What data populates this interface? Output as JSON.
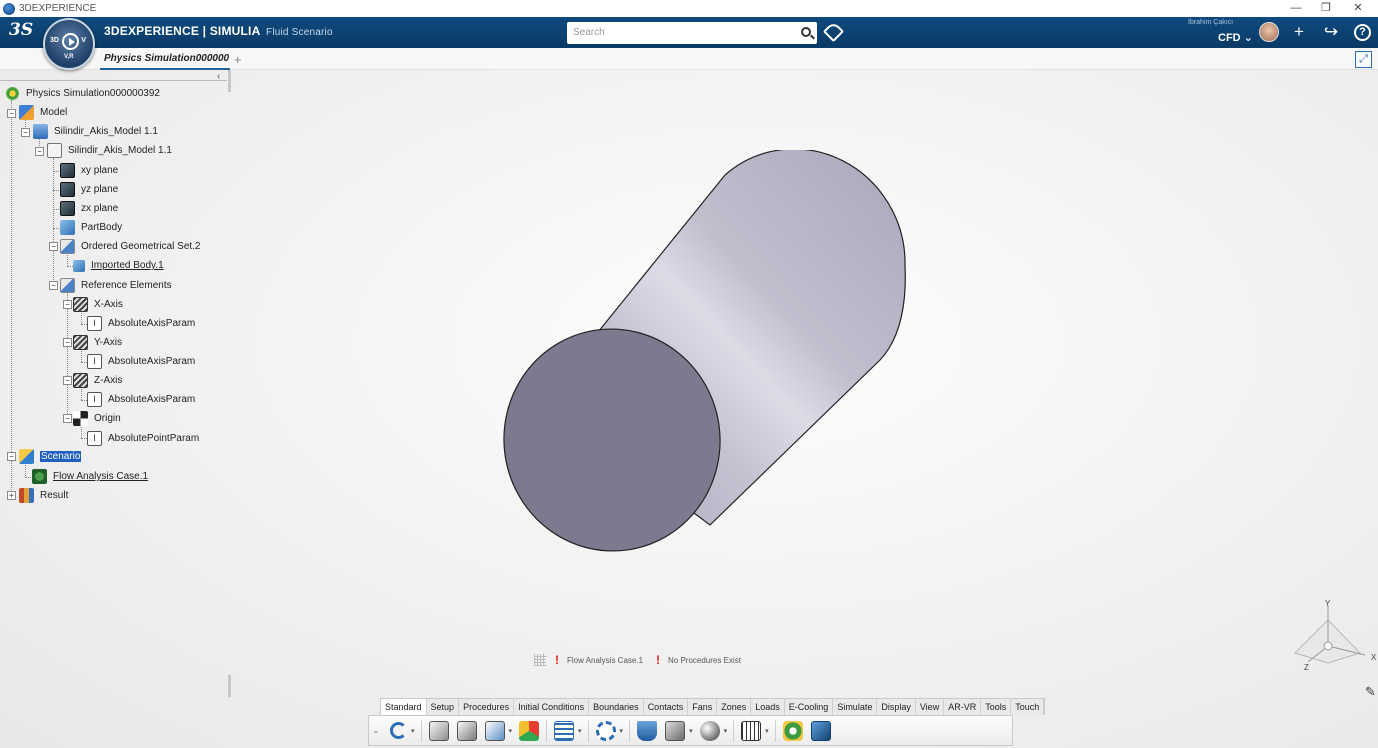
{
  "window": {
    "title": "3DEXPERIENCE",
    "minimize": "—",
    "restore": "❐",
    "close": "✕"
  },
  "topbar": {
    "logo": "3S",
    "compass_label_3d": "3D",
    "compass_label_v": "V",
    "compass_label_vr": "V,R",
    "brand_prefix": "3D",
    "brand_main": "EXPERIENCE | SIMULIA",
    "brand_app": "Fluid Scenario",
    "search_placeholder": "Search",
    "user_name": "İbrahim Çakıcı",
    "role": "CFD ⌄",
    "add_icon": "+",
    "share_icon": "↪",
    "help_icon": "?"
  },
  "tabs": {
    "active_tab": "Physics Simulation000000",
    "add": "+"
  },
  "tree": {
    "collapse": "‹",
    "nodes": [
      {
        "label": "Physics Simulation000000392"
      },
      {
        "label": "Model"
      },
      {
        "label": "Silindir_Akis_Model 1.1"
      },
      {
        "label": "Silindir_Akis_Model 1.1"
      },
      {
        "label": "xy plane"
      },
      {
        "label": "yz plane"
      },
      {
        "label": "zx plane"
      },
      {
        "label": "PartBody"
      },
      {
        "label": "Ordered Geometrical Set.2"
      },
      {
        "label": "Imported Body.1"
      },
      {
        "label": "Reference Elements"
      },
      {
        "label": "X-Axis"
      },
      {
        "label": "AbsoluteAxisParam"
      },
      {
        "label": "Y-Axis"
      },
      {
        "label": "AbsoluteAxisParam"
      },
      {
        "label": "Z-Axis"
      },
      {
        "label": "AbsoluteAxisParam"
      },
      {
        "label": "Origin"
      },
      {
        "label": "AbsolutePointParam"
      },
      {
        "label": "Scenario"
      },
      {
        "label": "Flow Analysis Case.1"
      },
      {
        "label": "Result"
      }
    ]
  },
  "status": {
    "case_message": "Flow Analysis Case.1",
    "procedures_message": "No Procedures Exist",
    "warn_glyph": "!"
  },
  "triad": {
    "x": "X",
    "y": "Y",
    "z": "Z"
  },
  "actionbar": {
    "tabs": [
      "Standard",
      "Setup",
      "Procedures",
      "Initial Conditions",
      "Boundaries",
      "Contacts",
      "Fans",
      "Zones",
      "Loads",
      "E-Cooling",
      "Simulate",
      "Display",
      "View",
      "AR-VR",
      "Tools",
      "Touch"
    ],
    "chevron": "⌄",
    "drop": "▾"
  },
  "colors": {
    "topbar": "#0f4a7e",
    "accent": "#1f5fbf",
    "cylinder_side": "#b9b8c8",
    "cylinder_cap": "#7b7a8f"
  }
}
